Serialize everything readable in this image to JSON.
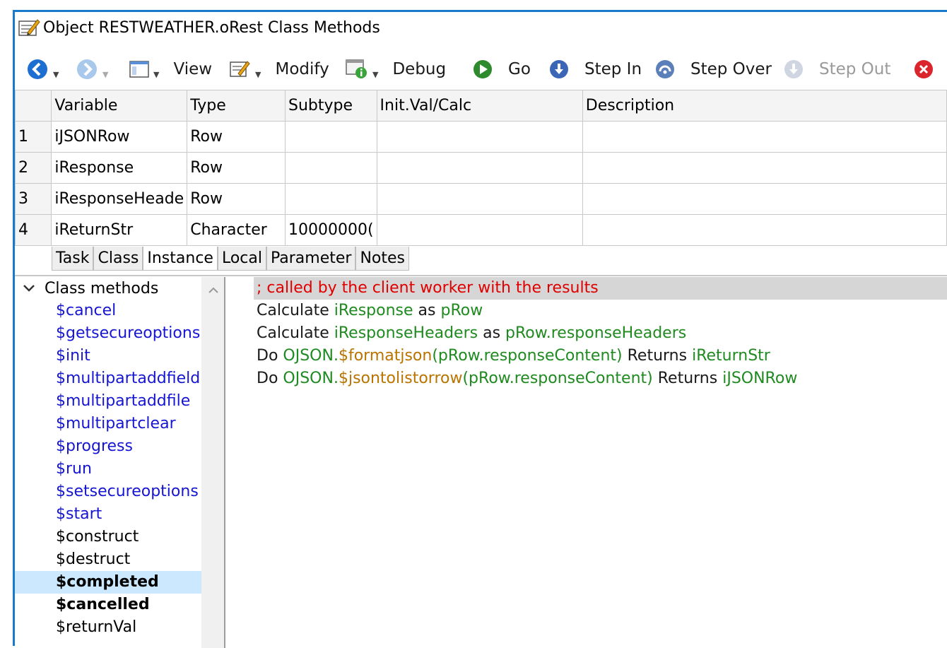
{
  "window": {
    "title": "Object RESTWEATHER.oRest Class Methods"
  },
  "toolbar": {
    "view": "View",
    "modify": "Modify",
    "debug": "Debug",
    "go": "Go",
    "step_in": "Step In",
    "step_over": "Step Over",
    "step_out": "Step Out"
  },
  "grid": {
    "headers": [
      "Variable",
      "Type",
      "Subtype",
      "Init.Val/Calc",
      "Description"
    ],
    "rows": [
      {
        "num": "1",
        "variable": "iJSONRow",
        "type": "Row",
        "subtype": "",
        "init": "",
        "desc": ""
      },
      {
        "num": "2",
        "variable": "iResponse",
        "type": "Row",
        "subtype": "",
        "init": "",
        "desc": ""
      },
      {
        "num": "3",
        "variable": "iResponseHeade",
        "type": "Row",
        "subtype": "",
        "init": "",
        "desc": ""
      },
      {
        "num": "4",
        "variable": "iReturnStr",
        "type": "Character",
        "subtype": "10000000(",
        "init": "",
        "desc": ""
      }
    ]
  },
  "tabs": [
    "Task",
    "Class",
    "Instance",
    "Local",
    "Parameter",
    "Notes"
  ],
  "tree": {
    "root": "Class methods",
    "items": [
      "$cancel",
      "$getsecureoptions",
      "$init",
      "$multipartaddfield",
      "$multipartaddfile",
      "$multipartclear",
      "$progress",
      "$run",
      "$setsecureoptions",
      "$start",
      "$construct",
      "$destruct",
      "$completed",
      "$cancelled",
      "$returnVal"
    ]
  },
  "code": {
    "comment": ";  called by the client worker with the results",
    "l1": {
      "kw": "Calculate",
      "var": "iResponse",
      "as": "as",
      "val": "pRow"
    },
    "l2": {
      "kw": "Calculate",
      "var": "iResponseHeaders",
      "as": "as",
      "val": "pRow.responseHeaders"
    },
    "l3": {
      "kw": "Do",
      "obj": "OJSON.",
      "fn": "$formatjson",
      "arg": "(pRow.responseContent)",
      "ret": "Returns",
      "var": "iReturnStr"
    },
    "l4": {
      "kw": "Do",
      "obj": "OJSON.",
      "fn": "$jsontolistorrow",
      "arg": "(pRow.responseContent)",
      "ret": "Returns",
      "var": "iJSONRow"
    }
  },
  "colors": {
    "accent": "#1979ca",
    "method_blue": "#1616d2",
    "selected": "#cce8ff",
    "comment": "#e00000",
    "code_var": "#1f8a1f",
    "code_func": "#b97400"
  }
}
